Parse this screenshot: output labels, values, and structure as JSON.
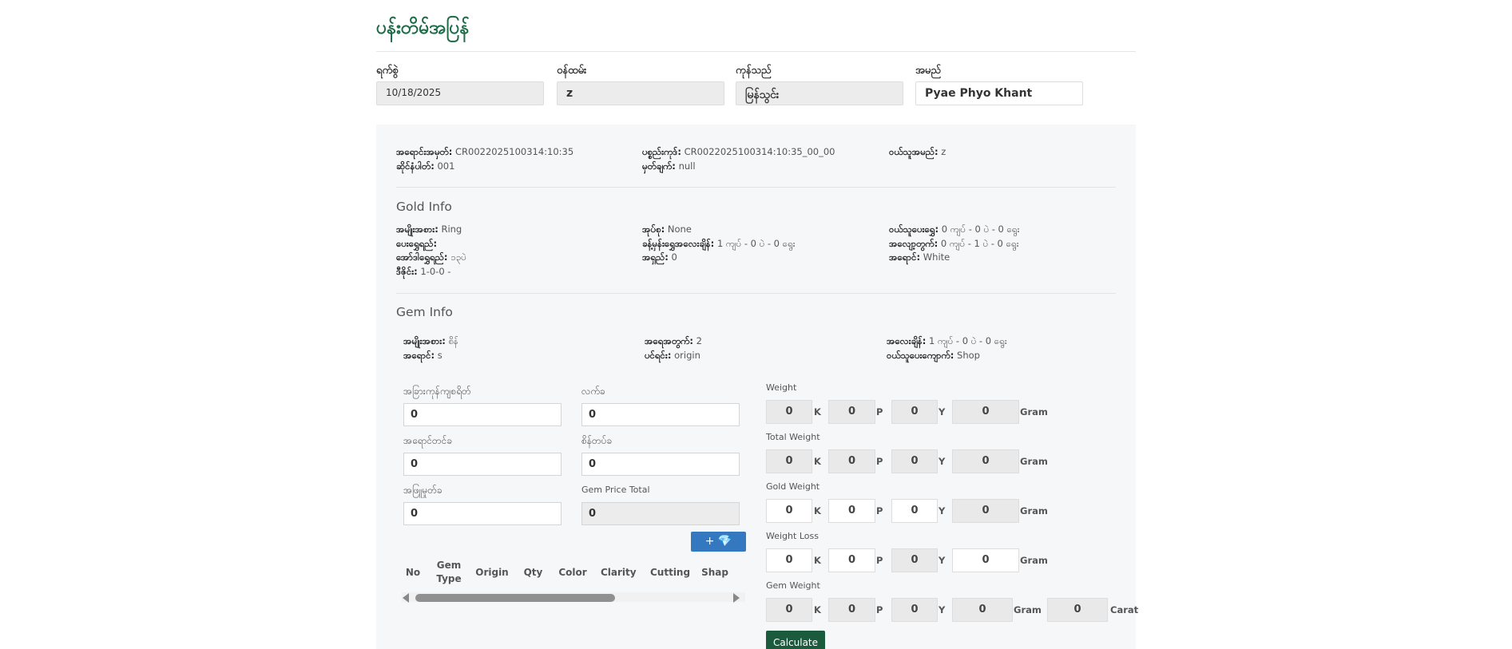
{
  "page": {
    "title": "ပန်းတိမ်အပြန်"
  },
  "top_fields": [
    {
      "label": "ရက်စွဲ",
      "value": "10/18/2025"
    },
    {
      "label": "ဝန်ထမ်း",
      "value": "z"
    },
    {
      "label": "ကုန်သည်",
      "value": "မြန်သွင်း"
    },
    {
      "label": "အမည်",
      "value": "Pyae Phyo Khant"
    }
  ],
  "order_info": {
    "voucher_label": "အရောင်းအမှတ်:",
    "voucher_value": "CR0022025100314:10:35",
    "order_code_label": "ပစ္စည်းကုဒ်:",
    "order_code_value": "CR0022025100314:10:35_00_00",
    "customer_label": "ဝယ်သူအမည်:",
    "customer_value": "z",
    "design_label": "ဆိုင်နံပါတ်:",
    "design_value": "001",
    "note_label": "မှတ်ချက်:",
    "note_value": "null"
  },
  "gold_info": {
    "title": "Gold Info",
    "type_label": "အမျိုးအစား:",
    "type_value": "Ring",
    "set_label": "အုပ်စု:",
    "set_value": "None",
    "buyer_weight_label": "ဝယ်သူပေးရွှေ:",
    "buyer_weight_value": "0 ကျပ် - 0 ပဲ - 0 ရွေး",
    "gold_quality_label": "ပေးရွှေရည်:",
    "gold_quality_value": "",
    "estimated_weight_label": "ခန့်မှန်းရွှေအလေးချိန်:",
    "estimated_weight_value": "1 ကျပ် - 0 ပဲ - 0 ရွေး",
    "extra_label": "အလျော့တွက်:",
    "extra_value": "0 ကျပ် - 1 ပဲ - 0 ရွေး",
    "order_quality_label": "အော်ဒါရွှေရည်:",
    "order_quality_value": "၁၃ပဲ",
    "purity_label": "အရှည်:",
    "purity_value": "0",
    "color_label": "အရောင်:",
    "color_value": "White",
    "design_label": "ဒီဇိုင်း:",
    "design_value": "1-0-0 -"
  },
  "gem_info": {
    "title": "Gem Info",
    "type_label": "အမျိုးအစား:",
    "type_value": "စိန်",
    "qty_label": "အရေအတွက်:",
    "qty_value": "2",
    "weight_label": "အလေးချိန်:",
    "weight_value": "1 ကျပ် - 0 ပဲ - 0 ရွေး",
    "color_label": "အရောင်:",
    "color_value": "s",
    "origin_label": "ပင်ရင်း:",
    "origin_value": "origin",
    "buyer_label": "ဝယ်သူပေးကျောက်:",
    "buyer_value": "Shop"
  },
  "cost_fields": {
    "other_label": "အခြားကုန်ကျစရိတ်",
    "other_value": "0",
    "labor_label": "လက်ခ",
    "labor_value": "0",
    "color_charge_label": "အရောင်တင်ခ",
    "color_charge_value": "0",
    "gem_setting_label": "စိန်တပ်ခ",
    "gem_setting_value": "0",
    "repair_label": "အဖြူမှုတ်ခ",
    "repair_value": "0",
    "gem_total_label": "Gem Price Total",
    "gem_total_value": "0"
  },
  "add_gem_button": {
    "label": "+ 💎"
  },
  "gem_table": {
    "headers": [
      "No",
      "Gem\nType",
      "Origin",
      "Qty",
      "Color",
      "Clarity",
      "Cutting",
      "Shap"
    ]
  },
  "weights": {
    "units": {
      "k": "K",
      "p": "P",
      "y": "Y",
      "gram": "Gram",
      "carat": "Carat"
    },
    "rows": [
      {
        "label": "Weight",
        "k": "0",
        "p": "0",
        "y": "0",
        "gram": "0"
      },
      {
        "label": "Total Weight",
        "k": "0",
        "p": "0",
        "y": "0",
        "gram": "0"
      },
      {
        "label": "Gold Weight",
        "k": "0",
        "p": "0",
        "y": "0",
        "gram": "0"
      },
      {
        "label": "Weight Loss",
        "k": "0",
        "p": "0",
        "y": "0",
        "gram": "0"
      },
      {
        "label": "Gem Weight",
        "k": "0",
        "p": "0",
        "y": "0",
        "gram": "0",
        "carat": "0"
      }
    ]
  },
  "calculate_button": {
    "label": "Calculate"
  },
  "colors": {
    "brand": "#1e6b47",
    "primary_button": "#3478bf",
    "calculate_button": "#1c5a3e"
  }
}
